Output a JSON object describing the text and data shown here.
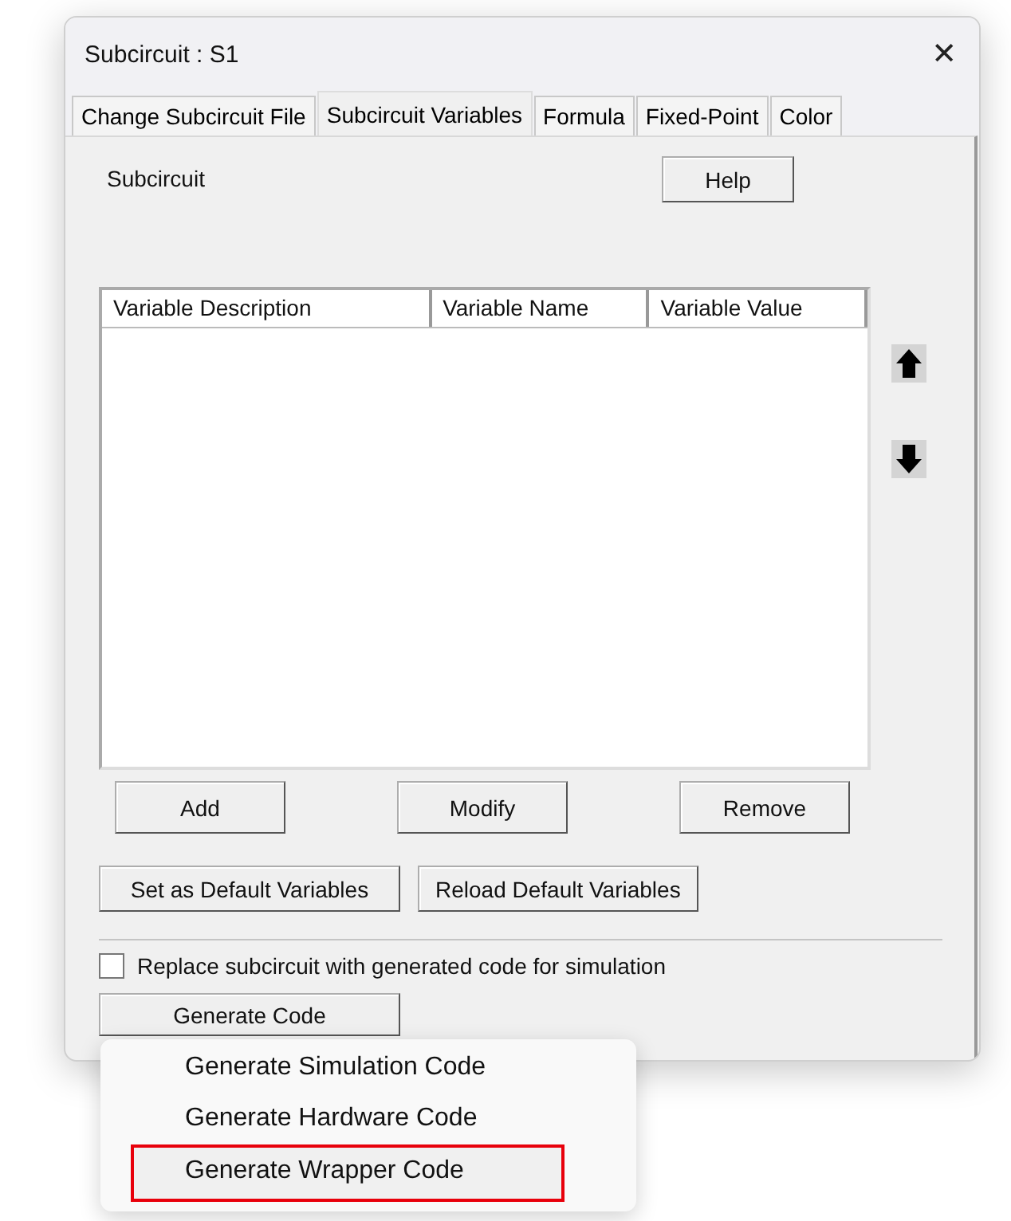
{
  "window": {
    "title": "Subcircuit : S1",
    "close": "✕"
  },
  "tabs": [
    {
      "label": "Change Subcircuit File",
      "selected": false
    },
    {
      "label": "Subcircuit Variables",
      "selected": true
    },
    {
      "label": "Formula",
      "selected": false
    },
    {
      "label": "Fixed-Point",
      "selected": false
    },
    {
      "label": "Color",
      "selected": false
    }
  ],
  "section_label": "Subcircuit",
  "help_button": "Help",
  "table": {
    "columns": [
      "Variable Description",
      "Variable Name",
      "Variable Value"
    ]
  },
  "row_buttons": [
    "Add",
    "Modify",
    "Remove"
  ],
  "default_buttons": [
    "Set as Default Variables",
    "Reload Default Variables"
  ],
  "replace_option": {
    "label": "Replace subcircuit with generated code for simulation",
    "checked": false
  },
  "generate_button": "Generate Code",
  "menu": [
    {
      "label": "Generate Simulation Code",
      "selected": false
    },
    {
      "label": "Generate Hardware Code",
      "selected": false
    },
    {
      "label": "Generate Wrapper Code",
      "selected": true
    }
  ]
}
